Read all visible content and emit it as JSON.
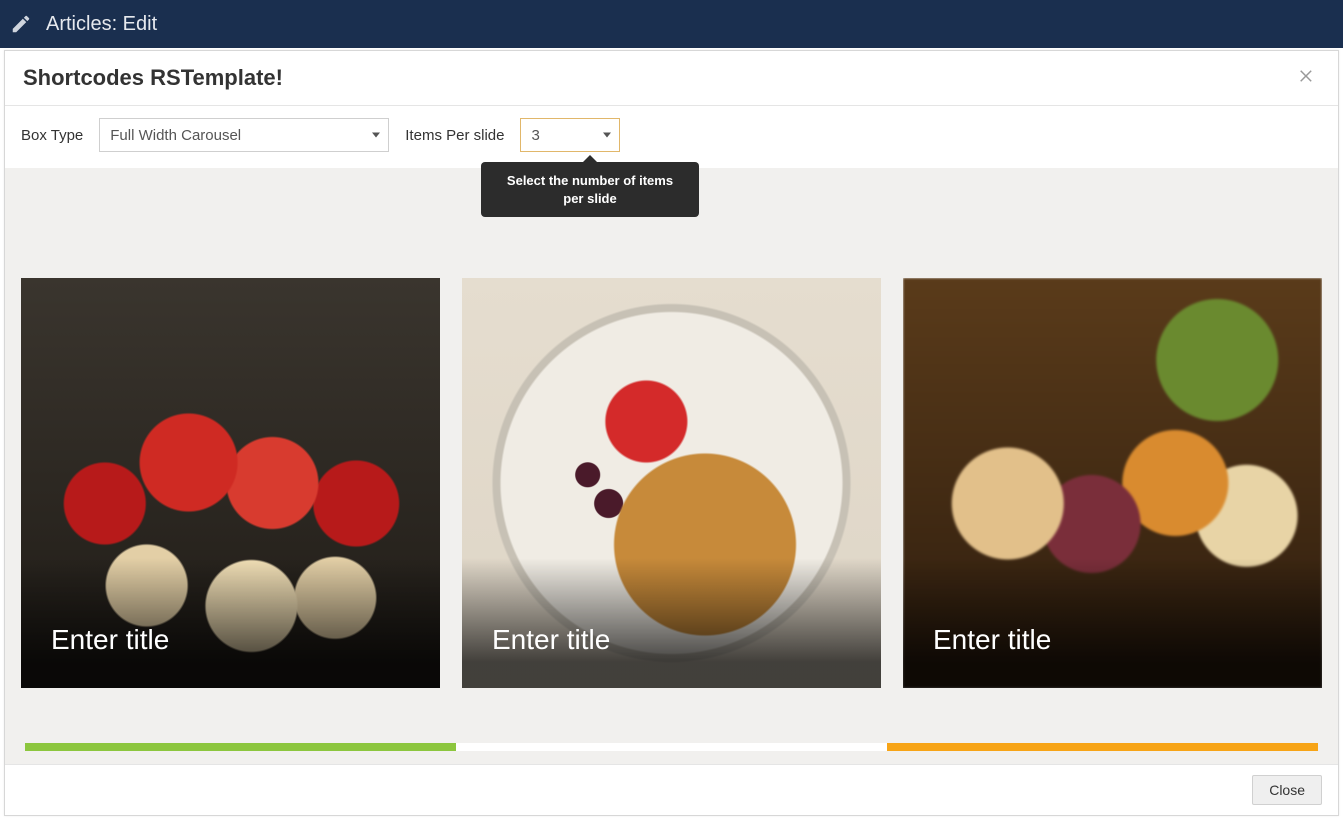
{
  "topbar": {
    "title": "Articles: Edit"
  },
  "modal": {
    "title": "Shortcodes RSTemplate!",
    "close_button": "Close"
  },
  "controls": {
    "box_type_label": "Box Type",
    "box_type_value": "Full Width Carousel",
    "items_per_slide_label": "Items Per slide",
    "items_per_slide_value": "3",
    "items_per_slide_tooltip": "Select the number of items per slide"
  },
  "carousel": {
    "items": [
      {
        "title": "Enter title",
        "image_desc": "strawberry-cupcakes"
      },
      {
        "title": "Enter title",
        "image_desc": "croissant-plate"
      },
      {
        "title": "Enter title",
        "image_desc": "grilled-skewers"
      }
    ],
    "pager_colors": [
      "#8cc63e",
      "#ffffff",
      "#f7a416"
    ]
  }
}
